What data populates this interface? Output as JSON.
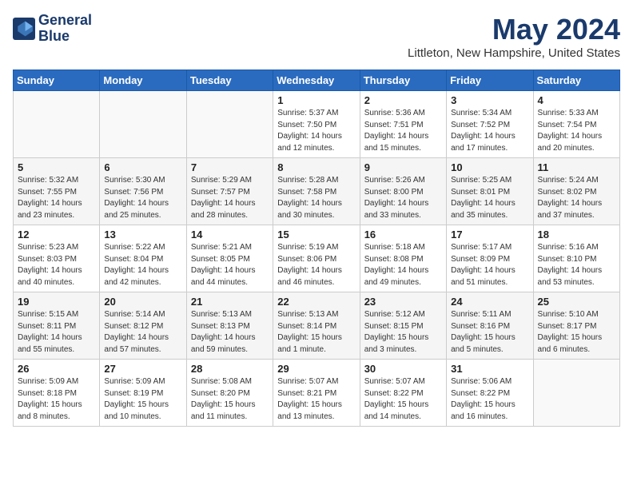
{
  "header": {
    "logo_line1": "General",
    "logo_line2": "Blue",
    "month": "May 2024",
    "location": "Littleton, New Hampshire, United States"
  },
  "weekdays": [
    "Sunday",
    "Monday",
    "Tuesday",
    "Wednesday",
    "Thursday",
    "Friday",
    "Saturday"
  ],
  "weeks": [
    [
      {
        "day": "",
        "info": ""
      },
      {
        "day": "",
        "info": ""
      },
      {
        "day": "",
        "info": ""
      },
      {
        "day": "1",
        "info": "Sunrise: 5:37 AM\nSunset: 7:50 PM\nDaylight: 14 hours\nand 12 minutes."
      },
      {
        "day": "2",
        "info": "Sunrise: 5:36 AM\nSunset: 7:51 PM\nDaylight: 14 hours\nand 15 minutes."
      },
      {
        "day": "3",
        "info": "Sunrise: 5:34 AM\nSunset: 7:52 PM\nDaylight: 14 hours\nand 17 minutes."
      },
      {
        "day": "4",
        "info": "Sunrise: 5:33 AM\nSunset: 7:54 PM\nDaylight: 14 hours\nand 20 minutes."
      }
    ],
    [
      {
        "day": "5",
        "info": "Sunrise: 5:32 AM\nSunset: 7:55 PM\nDaylight: 14 hours\nand 23 minutes."
      },
      {
        "day": "6",
        "info": "Sunrise: 5:30 AM\nSunset: 7:56 PM\nDaylight: 14 hours\nand 25 minutes."
      },
      {
        "day": "7",
        "info": "Sunrise: 5:29 AM\nSunset: 7:57 PM\nDaylight: 14 hours\nand 28 minutes."
      },
      {
        "day": "8",
        "info": "Sunrise: 5:28 AM\nSunset: 7:58 PM\nDaylight: 14 hours\nand 30 minutes."
      },
      {
        "day": "9",
        "info": "Sunrise: 5:26 AM\nSunset: 8:00 PM\nDaylight: 14 hours\nand 33 minutes."
      },
      {
        "day": "10",
        "info": "Sunrise: 5:25 AM\nSunset: 8:01 PM\nDaylight: 14 hours\nand 35 minutes."
      },
      {
        "day": "11",
        "info": "Sunrise: 5:24 AM\nSunset: 8:02 PM\nDaylight: 14 hours\nand 37 minutes."
      }
    ],
    [
      {
        "day": "12",
        "info": "Sunrise: 5:23 AM\nSunset: 8:03 PM\nDaylight: 14 hours\nand 40 minutes."
      },
      {
        "day": "13",
        "info": "Sunrise: 5:22 AM\nSunset: 8:04 PM\nDaylight: 14 hours\nand 42 minutes."
      },
      {
        "day": "14",
        "info": "Sunrise: 5:21 AM\nSunset: 8:05 PM\nDaylight: 14 hours\nand 44 minutes."
      },
      {
        "day": "15",
        "info": "Sunrise: 5:19 AM\nSunset: 8:06 PM\nDaylight: 14 hours\nand 46 minutes."
      },
      {
        "day": "16",
        "info": "Sunrise: 5:18 AM\nSunset: 8:08 PM\nDaylight: 14 hours\nand 49 minutes."
      },
      {
        "day": "17",
        "info": "Sunrise: 5:17 AM\nSunset: 8:09 PM\nDaylight: 14 hours\nand 51 minutes."
      },
      {
        "day": "18",
        "info": "Sunrise: 5:16 AM\nSunset: 8:10 PM\nDaylight: 14 hours\nand 53 minutes."
      }
    ],
    [
      {
        "day": "19",
        "info": "Sunrise: 5:15 AM\nSunset: 8:11 PM\nDaylight: 14 hours\nand 55 minutes."
      },
      {
        "day": "20",
        "info": "Sunrise: 5:14 AM\nSunset: 8:12 PM\nDaylight: 14 hours\nand 57 minutes."
      },
      {
        "day": "21",
        "info": "Sunrise: 5:13 AM\nSunset: 8:13 PM\nDaylight: 14 hours\nand 59 minutes."
      },
      {
        "day": "22",
        "info": "Sunrise: 5:13 AM\nSunset: 8:14 PM\nDaylight: 15 hours\nand 1 minute."
      },
      {
        "day": "23",
        "info": "Sunrise: 5:12 AM\nSunset: 8:15 PM\nDaylight: 15 hours\nand 3 minutes."
      },
      {
        "day": "24",
        "info": "Sunrise: 5:11 AM\nSunset: 8:16 PM\nDaylight: 15 hours\nand 5 minutes."
      },
      {
        "day": "25",
        "info": "Sunrise: 5:10 AM\nSunset: 8:17 PM\nDaylight: 15 hours\nand 6 minutes."
      }
    ],
    [
      {
        "day": "26",
        "info": "Sunrise: 5:09 AM\nSunset: 8:18 PM\nDaylight: 15 hours\nand 8 minutes."
      },
      {
        "day": "27",
        "info": "Sunrise: 5:09 AM\nSunset: 8:19 PM\nDaylight: 15 hours\nand 10 minutes."
      },
      {
        "day": "28",
        "info": "Sunrise: 5:08 AM\nSunset: 8:20 PM\nDaylight: 15 hours\nand 11 minutes."
      },
      {
        "day": "29",
        "info": "Sunrise: 5:07 AM\nSunset: 8:21 PM\nDaylight: 15 hours\nand 13 minutes."
      },
      {
        "day": "30",
        "info": "Sunrise: 5:07 AM\nSunset: 8:22 PM\nDaylight: 15 hours\nand 14 minutes."
      },
      {
        "day": "31",
        "info": "Sunrise: 5:06 AM\nSunset: 8:22 PM\nDaylight: 15 hours\nand 16 minutes."
      },
      {
        "day": "",
        "info": ""
      }
    ]
  ]
}
